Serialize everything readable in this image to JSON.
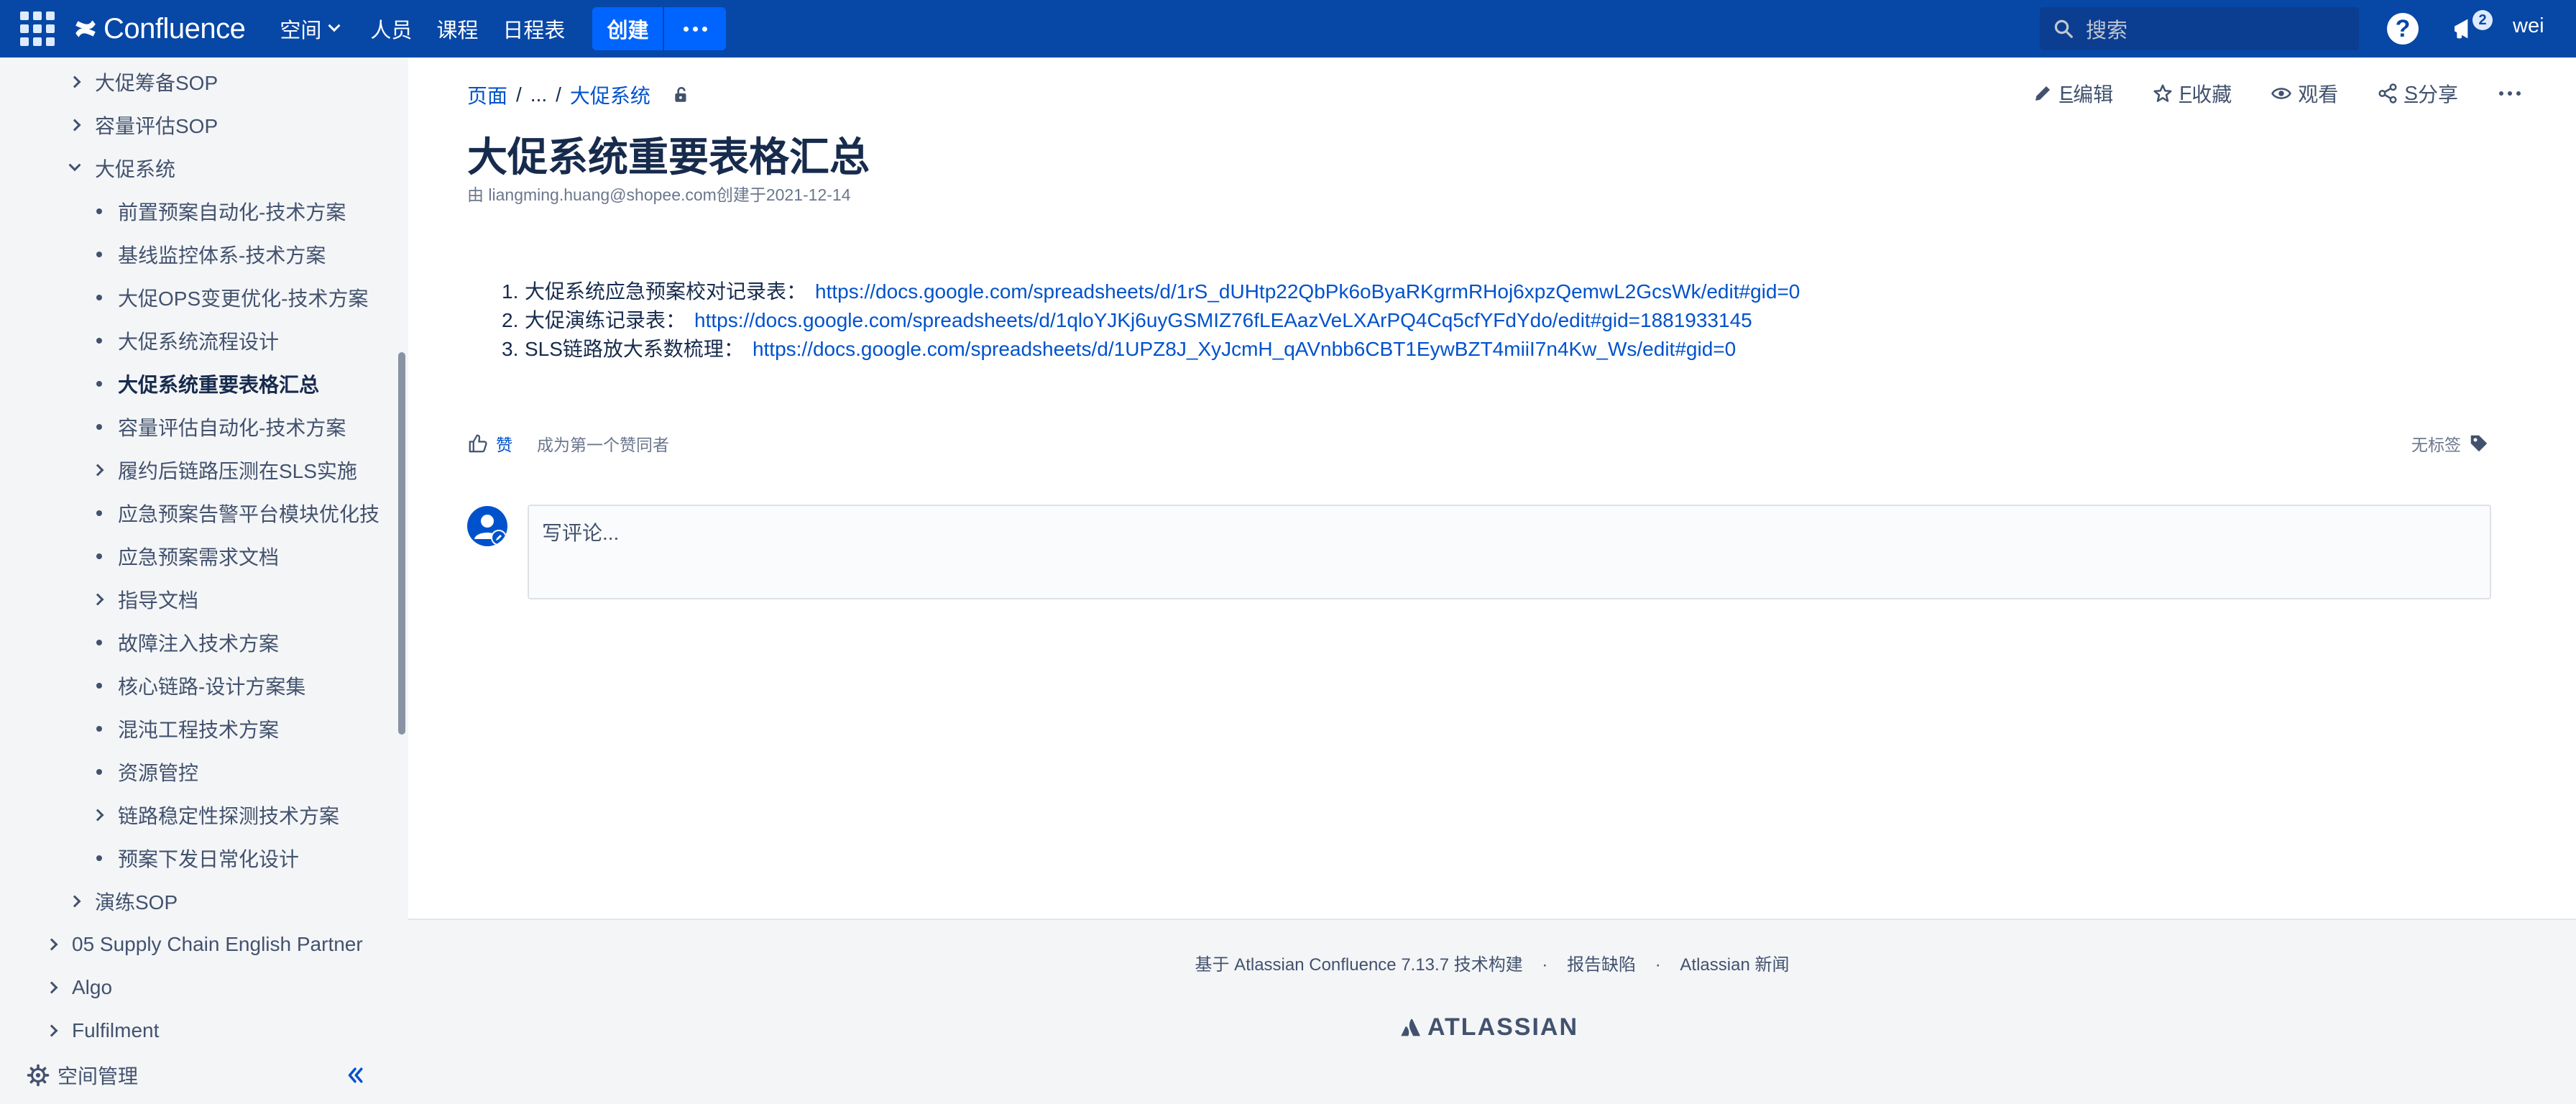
{
  "header": {
    "app_name": "Confluence",
    "nav": [
      {
        "label": "空间",
        "has_dropdown": true
      },
      {
        "label": "人员"
      },
      {
        "label": "课程"
      },
      {
        "label": "日程表"
      }
    ],
    "create_label": "创建",
    "search_placeholder": "搜索",
    "help_label": "?",
    "notification_count": "2",
    "user_label": "wei",
    "colors": {
      "bar": "#0747a6",
      "create": "#0065ff"
    }
  },
  "sidebar": {
    "items": [
      {
        "label": "大促筹备SOP",
        "marker": "chevron-right"
      },
      {
        "label": "容量评估SOP",
        "marker": "chevron-right"
      },
      {
        "label": "大促系统",
        "marker": "chevron-down"
      },
      {
        "label": "前置预案自动化-技术方案",
        "marker": "bullet"
      },
      {
        "label": "基线监控体系-技术方案",
        "marker": "bullet"
      },
      {
        "label": "大促OPS变更优化-技术方案",
        "marker": "bullet"
      },
      {
        "label": "大促系统流程设计",
        "marker": "bullet"
      },
      {
        "label": "大促系统重要表格汇总",
        "marker": "bullet",
        "active": true
      },
      {
        "label": "容量评估自动化-技术方案",
        "marker": "bullet"
      },
      {
        "label": "履约后链路压测在SLS实施",
        "marker": "chevron-right"
      },
      {
        "label": "应急预案告警平台模块优化技",
        "marker": "bullet"
      },
      {
        "label": "应急预案需求文档",
        "marker": "bullet"
      },
      {
        "label": "指导文档",
        "marker": "chevron-right"
      },
      {
        "label": "故障注入技术方案",
        "marker": "bullet"
      },
      {
        "label": "核心链路-设计方案集",
        "marker": "bullet"
      },
      {
        "label": "混沌工程技术方案",
        "marker": "bullet"
      },
      {
        "label": "资源管控",
        "marker": "bullet"
      },
      {
        "label": "链路稳定性探测技术方案",
        "marker": "chevron-right"
      },
      {
        "label": "预案下发日常化设计",
        "marker": "bullet"
      },
      {
        "label": "演练SOP",
        "marker": "chevron-right"
      },
      {
        "label": "05 Supply Chain English Partner",
        "marker": "chevron-right"
      },
      {
        "label": "Algo",
        "marker": "chevron-right"
      },
      {
        "label": "Fulfilment",
        "marker": "chevron-right"
      }
    ],
    "space_admin_label": "空间管理"
  },
  "breadcrumb": {
    "root": "页面",
    "ellipsis": "...",
    "parent": "大促系统"
  },
  "actions": {
    "edit_key": "E",
    "edit_label": "编辑",
    "fav_key": "F",
    "fav_label": "收藏",
    "watch_label": "观看",
    "share_key": "S",
    "share_label": "分享"
  },
  "page": {
    "title": "大促系统重要表格汇总",
    "byline": "由 liangming.huang@shopee.com创建于2021-12-14",
    "links": [
      {
        "num": "1.",
        "label": "大促系统应急预案校对记录表：",
        "url": "https://docs.google.com/spreadsheets/d/1rS_dUHtp22QbPk6oByaRKgrmRHoj6xpzQemwL2GcsWk/edit#gid=0"
      },
      {
        "num": "2.",
        "label": "大促演练记录表：",
        "url": "https://docs.google.com/spreadsheets/d/1qloYJKj6uyGSMIZ76fLEAazVeLXArPQ4Cq5cfYFdYdo/edit#gid=1881933145"
      },
      {
        "num": "3.",
        "label": "SLS链路放大系数梳理：",
        "url": "https://docs.google.com/spreadsheets/d/1UPZ8J_XyJcmH_qAVnbb6CBT1EywBZT4miiI7n4Kw_Ws/edit#gid=0"
      }
    ],
    "like_label": "赞",
    "first_liker_label": "成为第一个赞同者",
    "no_labels": "无标签",
    "comment_placeholder": "写评论..."
  },
  "footer": {
    "powered": "基于 Atlassian Confluence 7.13.7 技术构建",
    "report": "报告缺陷",
    "news": "Atlassian 新闻",
    "separator": "·",
    "logo_text": "ATLASSIAN"
  }
}
